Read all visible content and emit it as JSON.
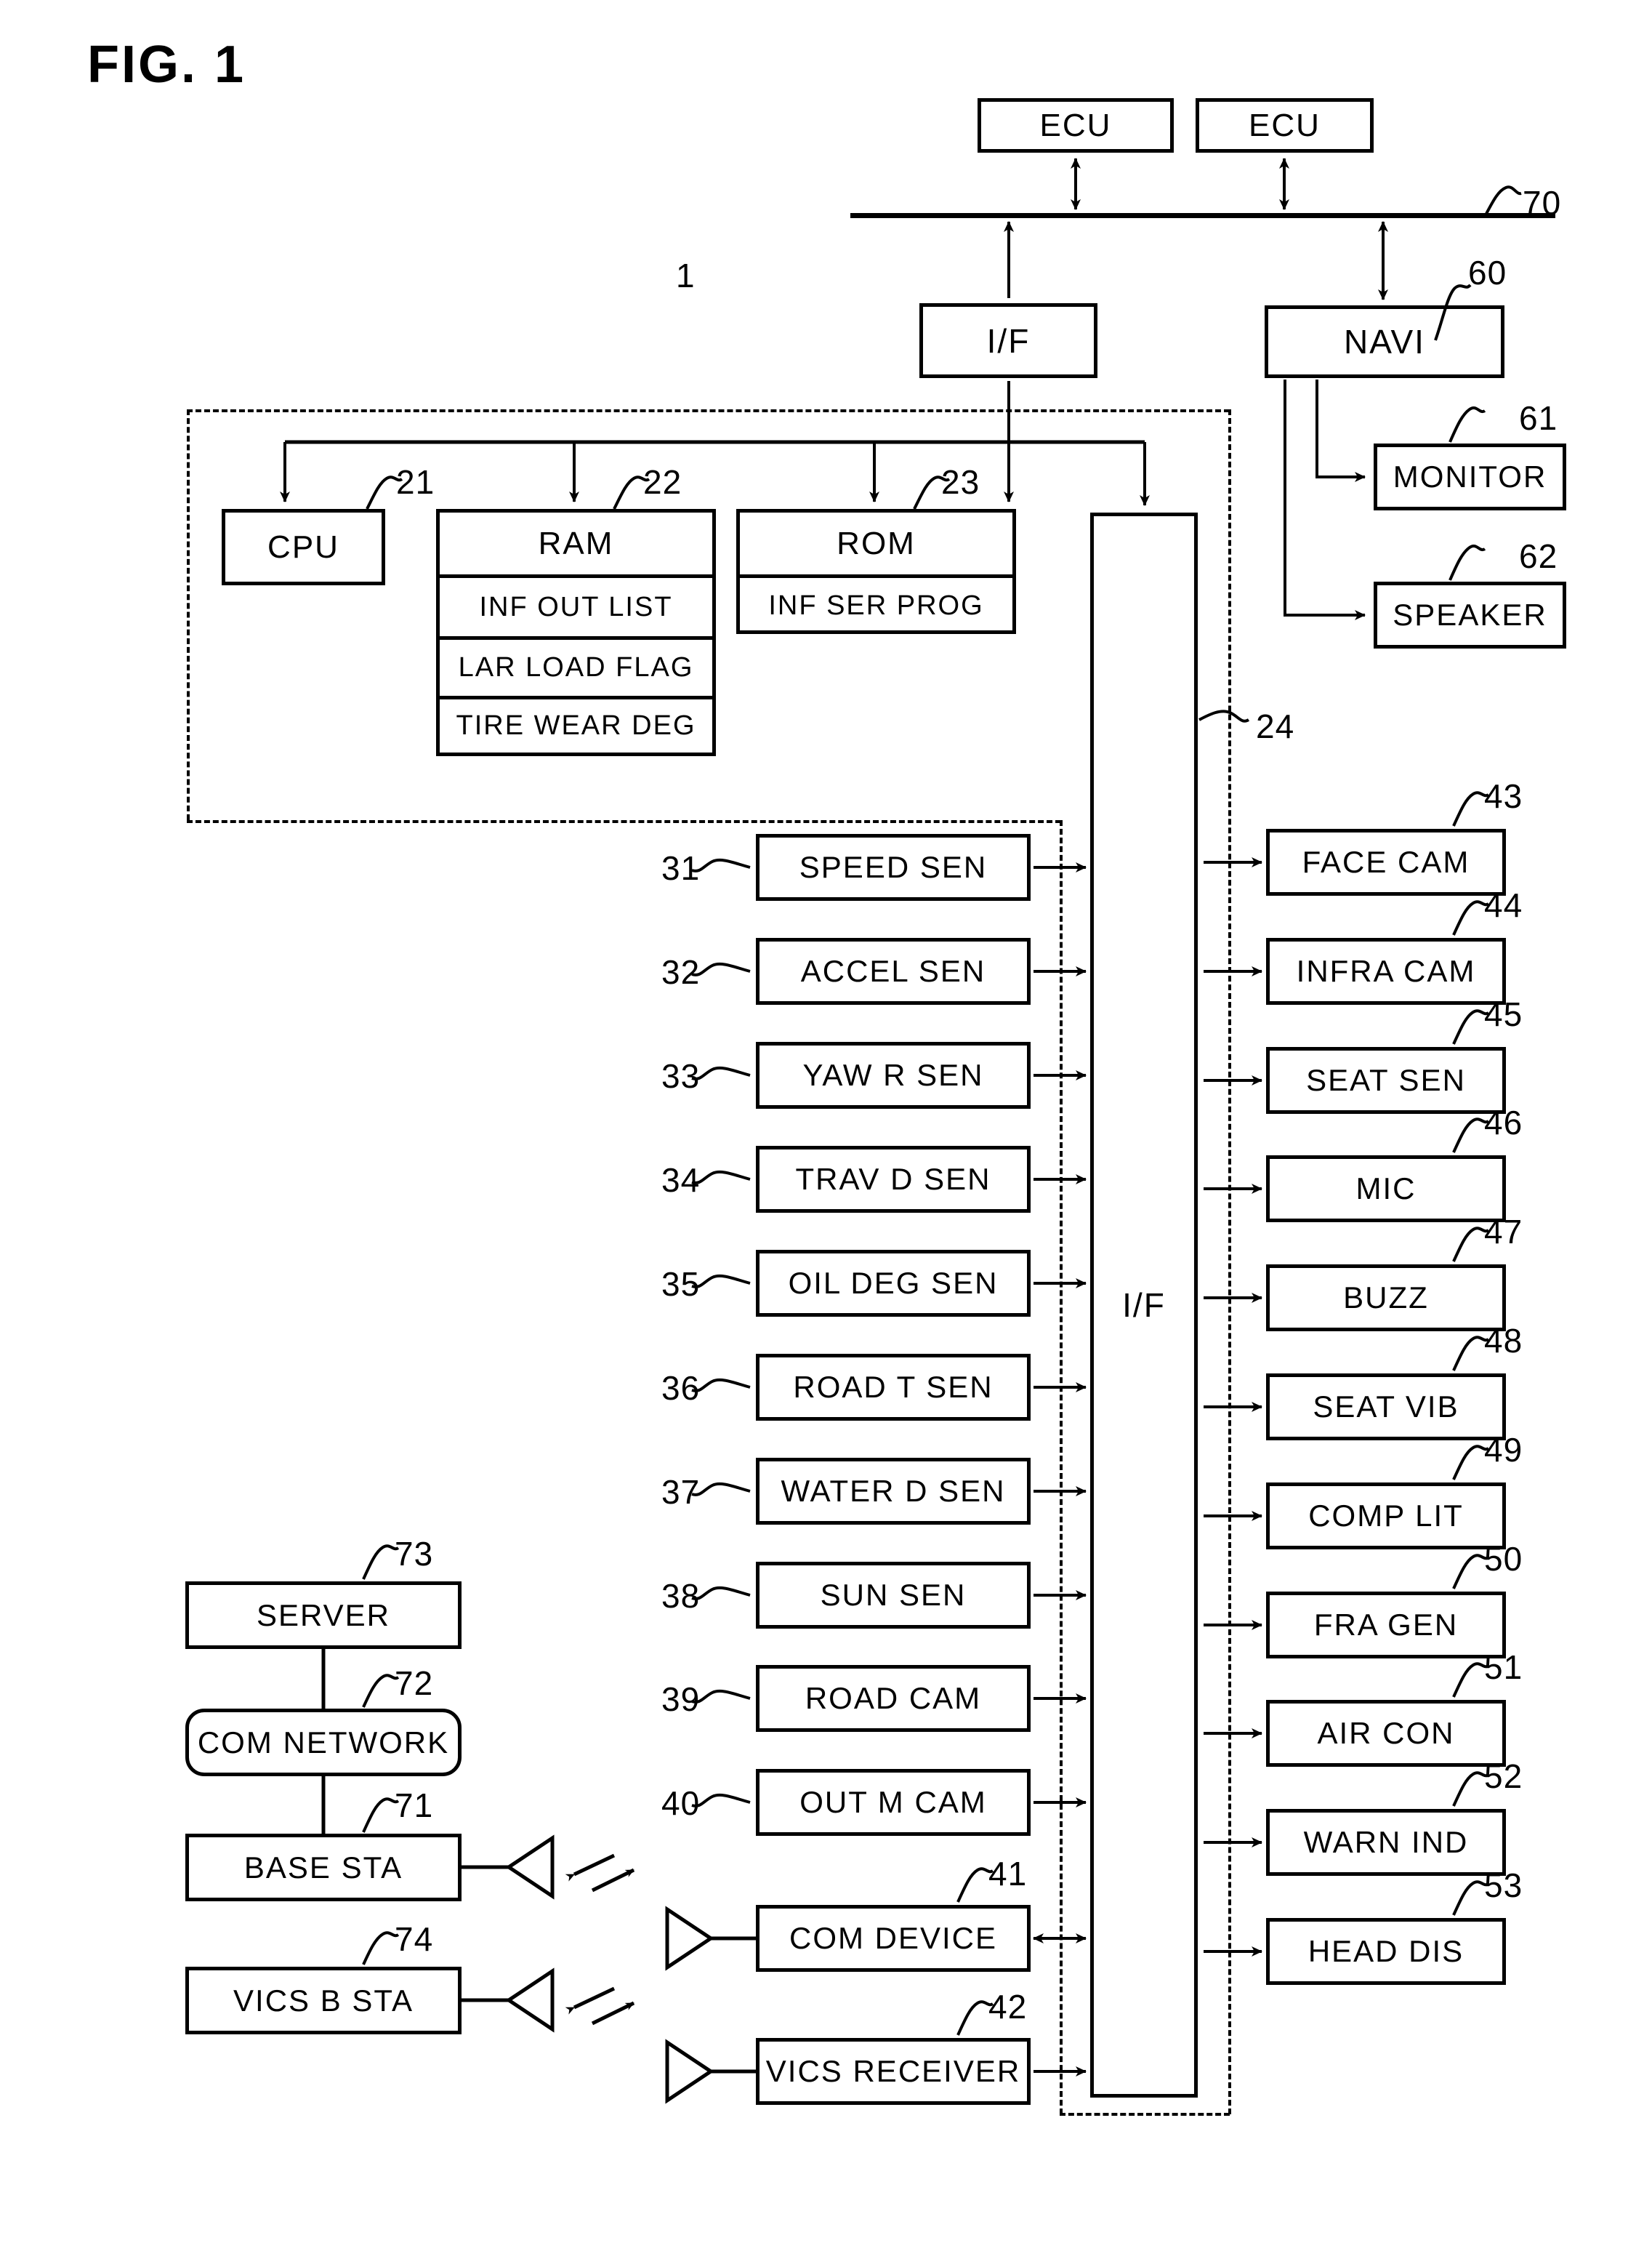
{
  "figure": {
    "title": "FIG. 1",
    "system_ref": "1"
  },
  "network": {
    "ecu_left": {
      "label": "ECU"
    },
    "ecu_right": {
      "label": "ECU"
    },
    "bus_ref": "70",
    "interface_top": {
      "label": "I/F"
    },
    "navi": {
      "label": "NAVI",
      "ref": "60"
    },
    "monitor": {
      "label": "MONITOR",
      "ref": "61"
    },
    "speaker": {
      "label": "SPEAKER",
      "ref": "62"
    }
  },
  "controller": {
    "cpu": {
      "label": "CPU",
      "ref": "21"
    },
    "ram": {
      "label": "RAM",
      "ref": "22",
      "cells": [
        "INF OUT LIST",
        "LAR LOAD FLAG",
        "TIRE WEAR DEG"
      ]
    },
    "rom": {
      "label": "ROM",
      "ref": "23",
      "cells": [
        "INF SER PROG"
      ]
    },
    "interface": {
      "label": "I/F",
      "ref": "24"
    }
  },
  "inputs": [
    {
      "ref": "31",
      "label": "SPEED SEN",
      "arrow": "right"
    },
    {
      "ref": "32",
      "label": "ACCEL SEN",
      "arrow": "right"
    },
    {
      "ref": "33",
      "label": "YAW R SEN",
      "arrow": "right"
    },
    {
      "ref": "34",
      "label": "TRAV D SEN",
      "arrow": "right"
    },
    {
      "ref": "35",
      "label": "OIL DEG SEN",
      "arrow": "right"
    },
    {
      "ref": "36",
      "label": "ROAD T SEN",
      "arrow": "right"
    },
    {
      "ref": "37",
      "label": "WATER D SEN",
      "arrow": "right"
    },
    {
      "ref": "38",
      "label": "SUN SEN",
      "arrow": "right"
    },
    {
      "ref": "39",
      "label": "ROAD CAM",
      "arrow": "right"
    },
    {
      "ref": "40",
      "label": "OUT M CAM",
      "arrow": "right"
    },
    {
      "ref": "41",
      "label": "COM DEVICE",
      "arrow": "both"
    },
    {
      "ref": "42",
      "label": "VICS RECEIVER",
      "arrow": "right"
    }
  ],
  "peripherals": [
    {
      "ref": "43",
      "label": "FACE CAM",
      "arrow": "left"
    },
    {
      "ref": "44",
      "label": "INFRA CAM",
      "arrow": "left"
    },
    {
      "ref": "45",
      "label": "SEAT SEN",
      "arrow": "left"
    },
    {
      "ref": "46",
      "label": "MIC",
      "arrow": "left"
    },
    {
      "ref": "47",
      "label": "BUZZ",
      "arrow": "right"
    },
    {
      "ref": "48",
      "label": "SEAT VIB",
      "arrow": "right"
    },
    {
      "ref": "49",
      "label": "COMP LIT",
      "arrow": "right"
    },
    {
      "ref": "50",
      "label": "FRA GEN",
      "arrow": "right"
    },
    {
      "ref": "51",
      "label": "AIR CON",
      "arrow": "right"
    },
    {
      "ref": "52",
      "label": "WARN IND",
      "arrow": "right"
    },
    {
      "ref": "53",
      "label": "HEAD DIS",
      "arrow": "right"
    }
  ],
  "infrastructure": {
    "server": {
      "label": "SERVER",
      "ref": "73"
    },
    "com_network": {
      "label": "COM NETWORK",
      "ref": "72"
    },
    "base_station": {
      "label": "BASE STA",
      "ref": "71"
    },
    "vics_station": {
      "label": "VICS B STA",
      "ref": "74"
    }
  },
  "colors": {
    "ink": "#000000",
    "paper": "#ffffff"
  }
}
